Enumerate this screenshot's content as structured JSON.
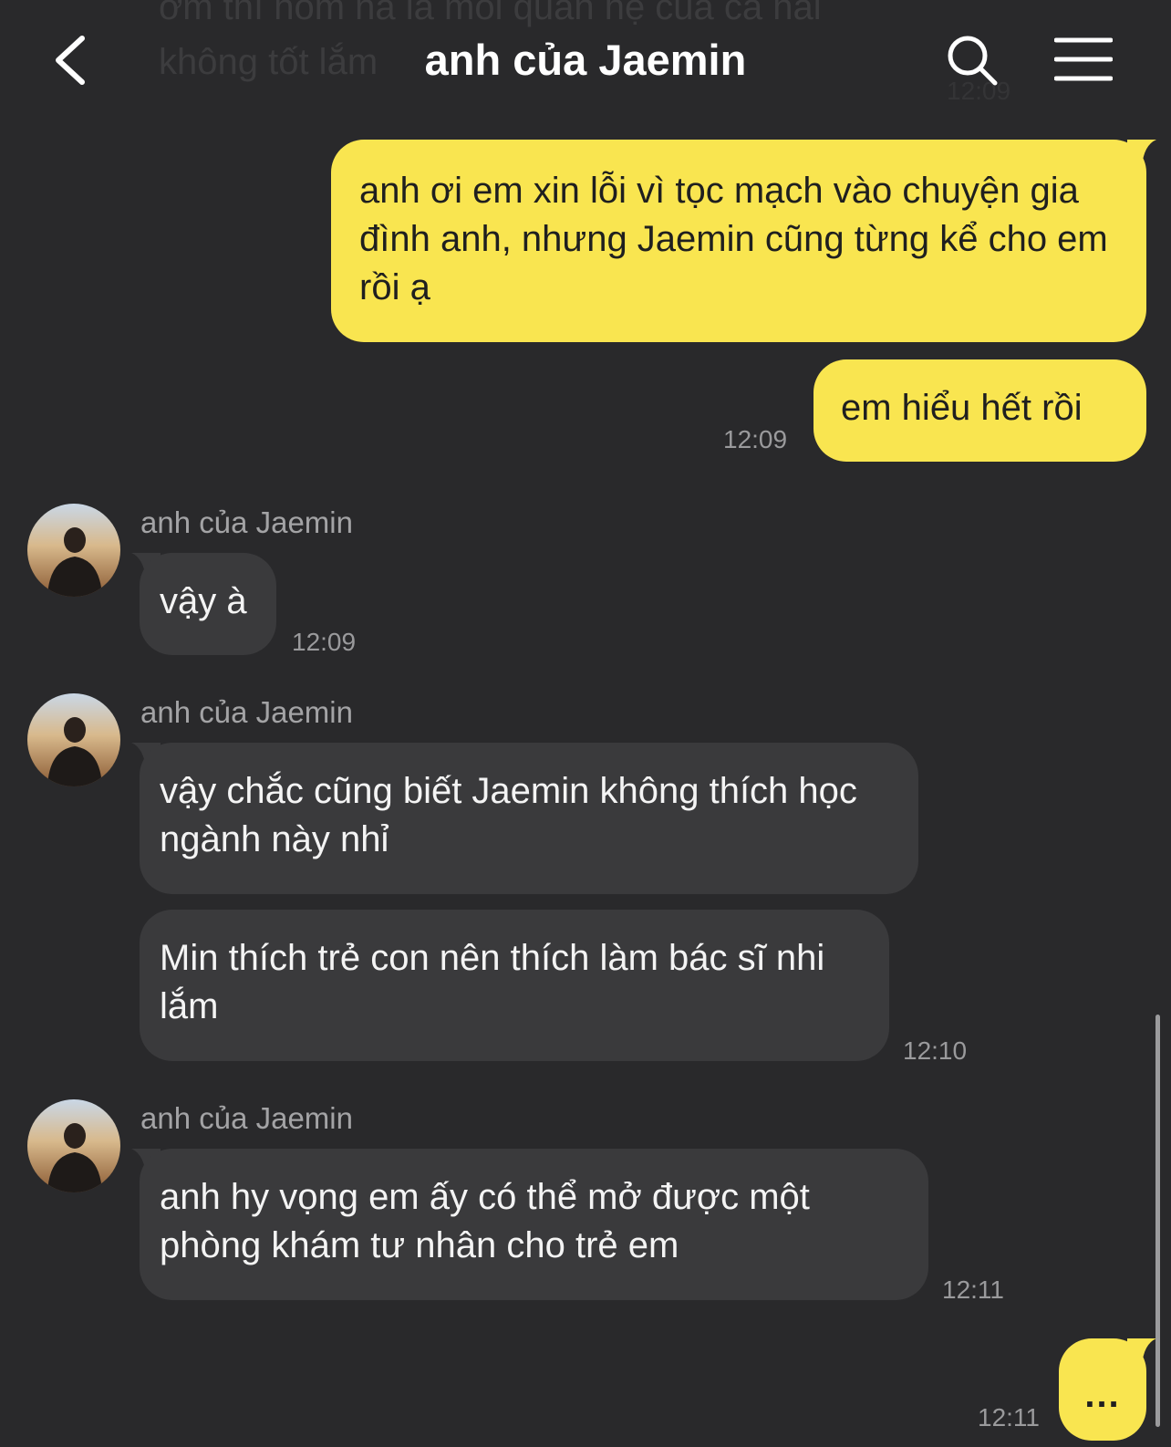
{
  "header": {
    "title": "anh của Jaemin",
    "back_icon": "chevron-left-icon",
    "search_icon": "search-icon",
    "menu_icon": "hamburger-menu-icon"
  },
  "ghost_message": {
    "text": "ơm thì hôm nà là mối quan hệ của cả hai không tốt lắm",
    "time": "12:09"
  },
  "messages": {
    "m1": {
      "text": "anh ơi em xin lỗi vì tọc mạch vào chuyện gia đình anh, nhưng Jaemin cũng từng kể cho em rồi ạ"
    },
    "m2": {
      "text": "em hiểu hết rồi",
      "time": "12:09"
    },
    "m3": {
      "sender": "anh của Jaemin",
      "text": "vậy à",
      "time": "12:09"
    },
    "m4": {
      "sender": "anh của Jaemin",
      "text": "vậy chắc cũng biết Jaemin không thích học ngành này nhỉ"
    },
    "m5": {
      "text": "Min thích trẻ con nên thích làm bác sĩ nhi lắm",
      "time": "12:10"
    },
    "m6": {
      "sender": "anh của Jaemin",
      "text": "anh hy vọng em ấy có thể mở được một phòng khám tư nhân cho trẻ em",
      "time": "12:11"
    },
    "m7": {
      "text": "...",
      "time": "12:11"
    }
  },
  "colors": {
    "background": "#29292b",
    "my_bubble": "#f9e550",
    "their_bubble": "#3a3a3c"
  }
}
